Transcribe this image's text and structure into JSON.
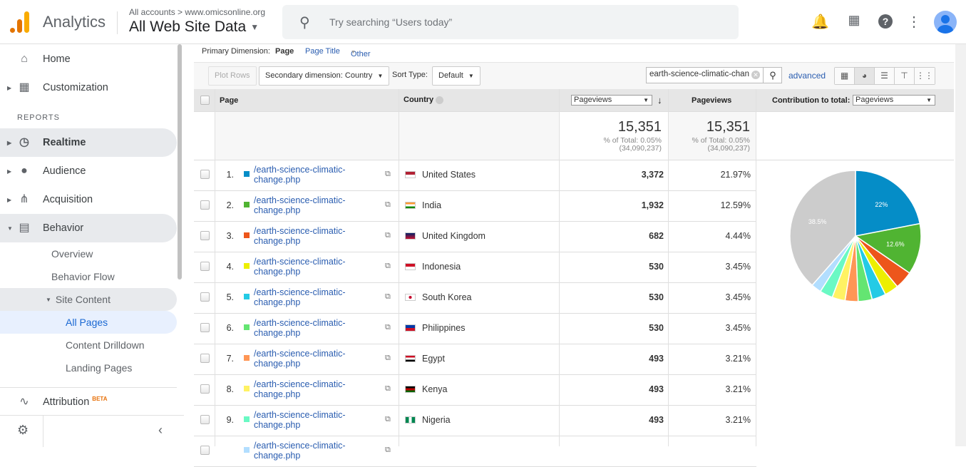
{
  "header": {
    "app_name": "Analytics",
    "breadcrumb": "All accounts > www.omicsonline.org",
    "view": "All Web Site Data",
    "search_placeholder": "Try searching “Users today”",
    "icons": [
      "bell-icon",
      "apps-icon",
      "help-icon",
      "more-vert-icon",
      "avatar"
    ]
  },
  "sidebar": {
    "items": [
      {
        "label": "Home",
        "icon": "home-icon"
      },
      {
        "label": "Customization",
        "icon": "customization-icon"
      }
    ],
    "section": "REPORTS",
    "reports": [
      {
        "label": "Realtime",
        "icon": "clock-icon"
      },
      {
        "label": "Audience",
        "icon": "person-icon"
      },
      {
        "label": "Acquisition",
        "icon": "acquisition-icon"
      },
      {
        "label": "Behavior",
        "icon": "behavior-icon"
      }
    ],
    "behavior_sub": [
      "Overview",
      "Behavior Flow",
      "Site Content"
    ],
    "site_content_sub": [
      "All Pages",
      "Content Drilldown",
      "Landing Pages"
    ],
    "attribution": "Attribution",
    "beta": "BETA"
  },
  "primary_dimension": {
    "label": "Primary Dimension:",
    "active": "Page",
    "options": [
      "Page Title",
      "Other"
    ]
  },
  "toolbar": {
    "plot_rows": "Plot Rows",
    "secondary": "Secondary dimension: Country",
    "sort_label": "Sort Type:",
    "sort_value": "Default",
    "filter_value": "earth-science-climatic-change",
    "advanced": "advanced"
  },
  "table": {
    "headers": {
      "page": "Page",
      "country": "Country",
      "metric_select": "Pageviews",
      "pageviews": "Pageviews",
      "contribution_label": "Contribution to total:",
      "contribution_select": "Pageviews"
    },
    "totals": {
      "value": "15,351",
      "pct": "% of Total: 0.05%",
      "of": "(34,090,237)",
      "value2": "15,351",
      "pct2": "% of Total: 0.05%",
      "of2": "(34,090,237)"
    },
    "rows": [
      {
        "n": "1.",
        "page": "/earth-science-climatic-change.php",
        "country": "United States",
        "pv": "3,372",
        "pct": "21.97%",
        "color": "#058dc7"
      },
      {
        "n": "2.",
        "page": "/earth-science-climatic-change.php",
        "country": "India",
        "pv": "1,932",
        "pct": "12.59%",
        "color": "#50b432"
      },
      {
        "n": "3.",
        "page": "/earth-science-climatic-change.php",
        "country": "United Kingdom",
        "pv": "682",
        "pct": "4.44%",
        "color": "#ed561b"
      },
      {
        "n": "4.",
        "page": "/earth-science-climatic-change.php",
        "country": "Indonesia",
        "pv": "530",
        "pct": "3.45%",
        "color": "#edef00"
      },
      {
        "n": "5.",
        "page": "/earth-science-climatic-change.php",
        "country": "South Korea",
        "pv": "530",
        "pct": "3.45%",
        "color": "#24cbe5"
      },
      {
        "n": "6.",
        "page": "/earth-science-climatic-change.php",
        "country": "Philippines",
        "pv": "530",
        "pct": "3.45%",
        "color": "#64e572"
      },
      {
        "n": "7.",
        "page": "/earth-science-climatic-change.php",
        "country": "Egypt",
        "pv": "493",
        "pct": "3.21%",
        "color": "#ff9655"
      },
      {
        "n": "8.",
        "page": "/earth-science-climatic-change.php",
        "country": "Kenya",
        "pv": "493",
        "pct": "3.21%",
        "color": "#fff263"
      },
      {
        "n": "9.",
        "page": "/earth-science-climatic-change.php",
        "country": "Nigeria",
        "pv": "493",
        "pct": "3.21%",
        "color": "#6af9c4"
      },
      {
        "n": "",
        "page": "/earth-science-climatic-change.php",
        "country": "",
        "pv": "",
        "pct": "",
        "color": "#b2deff"
      }
    ],
    "pie": {
      "values": [
        21.97,
        12.59,
        4.44,
        3.45,
        3.45,
        3.45,
        3.21,
        3.21,
        3.21,
        2.5,
        38.5
      ],
      "colors": [
        "#058dc7",
        "#50b432",
        "#ed561b",
        "#edef00",
        "#24cbe5",
        "#64e572",
        "#ff9655",
        "#fff263",
        "#6af9c4",
        "#b2deff",
        "#cccccc"
      ],
      "labels": [
        "22%",
        "12.6%",
        "",
        "",
        "",
        "",
        "",
        "",
        "",
        "",
        "38.5%"
      ]
    }
  }
}
